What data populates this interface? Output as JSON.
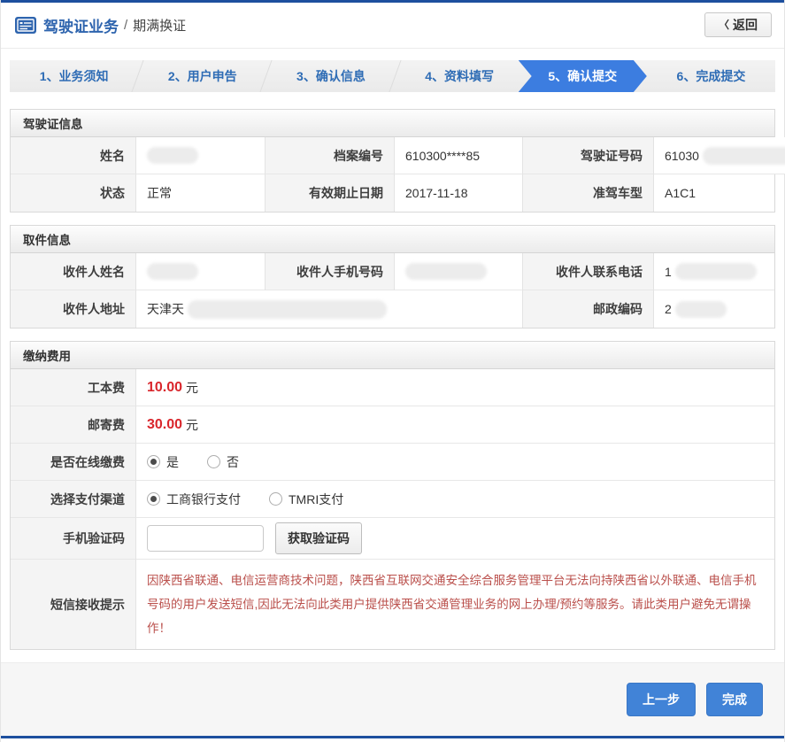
{
  "colors": {
    "navy": "#1d4f9e",
    "accent_blue": "#3c7de0",
    "button_blue": "#4183d7",
    "fee_red": "#d9262c",
    "warning_red": "#ba4f4b"
  },
  "header": {
    "title": "驾驶证业务",
    "separator": "/",
    "subtitle": "期满换证",
    "back_chevron": "〈",
    "back_label": "返回"
  },
  "steps": [
    {
      "label": "1、业务须知",
      "active": false
    },
    {
      "label": "2、用户申告",
      "active": false
    },
    {
      "label": "3、确认信息",
      "active": false
    },
    {
      "label": "4、资料填写",
      "active": false
    },
    {
      "label": "5、确认提交",
      "active": true
    },
    {
      "label": "6、完成提交",
      "active": false
    }
  ],
  "license_info": {
    "title": "驾驶证信息",
    "row1": {
      "name_label": "姓名",
      "name_value": "",
      "file_no_label": "档案编号",
      "file_no_value": "610300****85",
      "license_no_label": "驾驶证号码",
      "license_no_value": "61030"
    },
    "row2": {
      "status_label": "状态",
      "status_value": "正常",
      "expiry_label": "有效期止日期",
      "expiry_value": "2017-11-18",
      "vehicle_label": "准驾车型",
      "vehicle_value": "A1C1"
    }
  },
  "pickup_info": {
    "title": "取件信息",
    "row1": {
      "recipient_name_label": "收件人姓名",
      "recipient_name_value": "",
      "mobile_label": "收件人手机号码",
      "mobile_value": "",
      "phone_label": "收件人联系电话",
      "phone_value": "1"
    },
    "row2": {
      "address_label": "收件人地址",
      "address_value": "天津天",
      "postcode_label": "邮政编码",
      "postcode_value": "2"
    }
  },
  "payment": {
    "title": "缴纳费用",
    "fee1": {
      "label": "工本费",
      "amount": "10.00",
      "unit": "元"
    },
    "fee2": {
      "label": "邮寄费",
      "amount": "30.00",
      "unit": "元"
    },
    "online_pay": {
      "label": "是否在线缴费",
      "options": [
        {
          "label": "是",
          "checked": true
        },
        {
          "label": "否",
          "checked": false
        }
      ]
    },
    "channel": {
      "label": "选择支付渠道",
      "options": [
        {
          "label": "工商银行支付",
          "checked": true
        },
        {
          "label": "TMRI支付",
          "checked": false
        }
      ]
    },
    "sms_code": {
      "label": "手机验证码",
      "input_value": "",
      "button_label": "获取验证码"
    },
    "sms_notice": {
      "label": "短信接收提示",
      "text": "因陕西省联通、电信运营商技术问题，陕西省互联网交通安全综合服务管理平台无法向持陕西省以外联通、电信手机号码的用户发送短信,因此无法向此类用户提供陕西省交通管理业务的网上办理/预约等服务。请此类用户避免无谓操作！"
    }
  },
  "footer": {
    "prev_label": "上一步",
    "finish_label": "完成"
  }
}
